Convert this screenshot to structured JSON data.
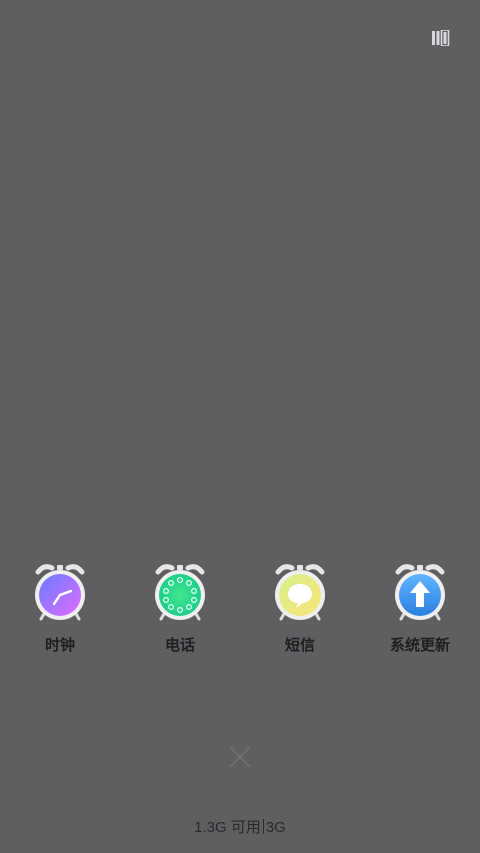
{
  "apps": [
    {
      "label": "时钟",
      "icon": "clock-app-icon"
    },
    {
      "label": "电话",
      "icon": "phone-app-icon"
    },
    {
      "label": "短信",
      "icon": "messages-app-icon"
    },
    {
      "label": "系统更新",
      "icon": "system-update-app-icon"
    }
  ],
  "memory": {
    "available": "1.3G 可用",
    "total": "3G"
  },
  "icons": {
    "top_right": "multi-window-icon",
    "close": "close-icon"
  },
  "colors": {
    "background": "#5f5e61",
    "label": "#1f1f21"
  }
}
